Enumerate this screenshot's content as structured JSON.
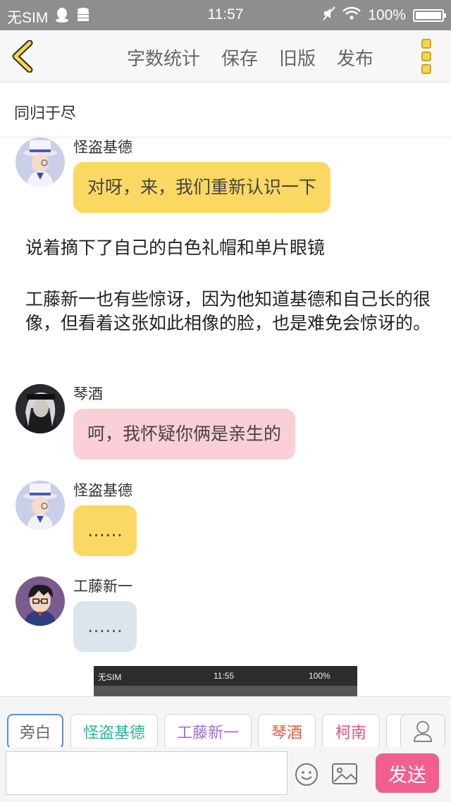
{
  "status_bar": {
    "carrier": "无SIM",
    "time": "11:57",
    "battery_text": "100%",
    "battery_level": 1.0
  },
  "nav": {
    "actions": [
      "字数统计",
      "保存",
      "旧版",
      "发布"
    ]
  },
  "title": "同归于尽",
  "messages": [
    {
      "type": "chat",
      "speaker": "怪盗基德",
      "text": "对呀，来，我们重新认识一下",
      "color": "yellow",
      "avatar": "kid-avatar"
    },
    {
      "type": "narration",
      "text": "说着摘下了自己的白色礼帽和单片眼镜"
    },
    {
      "type": "narration",
      "text": "工藤新一也有些惊讶，因为他知道基德和自己长的很像，但看着这张如此相像的脸，也是难免会惊讶的。"
    },
    {
      "type": "chat",
      "speaker": "琴酒",
      "text": "呵，我怀疑你俩是亲生的",
      "color": "pink",
      "avatar": "gin-avatar"
    },
    {
      "type": "chat",
      "speaker": "怪盗基德",
      "text": "……",
      "color": "yellow",
      "avatar": "kid-avatar"
    },
    {
      "type": "chat",
      "speaker": "工藤新一",
      "text": "……",
      "color": "blue",
      "avatar": "shinichi-avatar"
    }
  ],
  "preview_image": {
    "carrier": "无SIM",
    "time": "11:55",
    "battery_text": "100%"
  },
  "roles": [
    {
      "label": "旁白",
      "color": "#666666"
    },
    {
      "label": "怪盗基德",
      "color": "#2ab39b"
    },
    {
      "label": "工藤新一",
      "color": "#a56bcf"
    },
    {
      "label": "琴酒",
      "color": "#e05a3a"
    },
    {
      "label": "柯南",
      "color": "#e0508a"
    }
  ],
  "input": {
    "value": "",
    "send_label": "发送"
  },
  "colors": {
    "yellow_bubble": "#fbd862",
    "pink_bubble": "#fbcfd7",
    "blue_bubble": "#dce5ec",
    "send_button": "#f25f8f",
    "accent_yellow": "#f5d54c"
  }
}
